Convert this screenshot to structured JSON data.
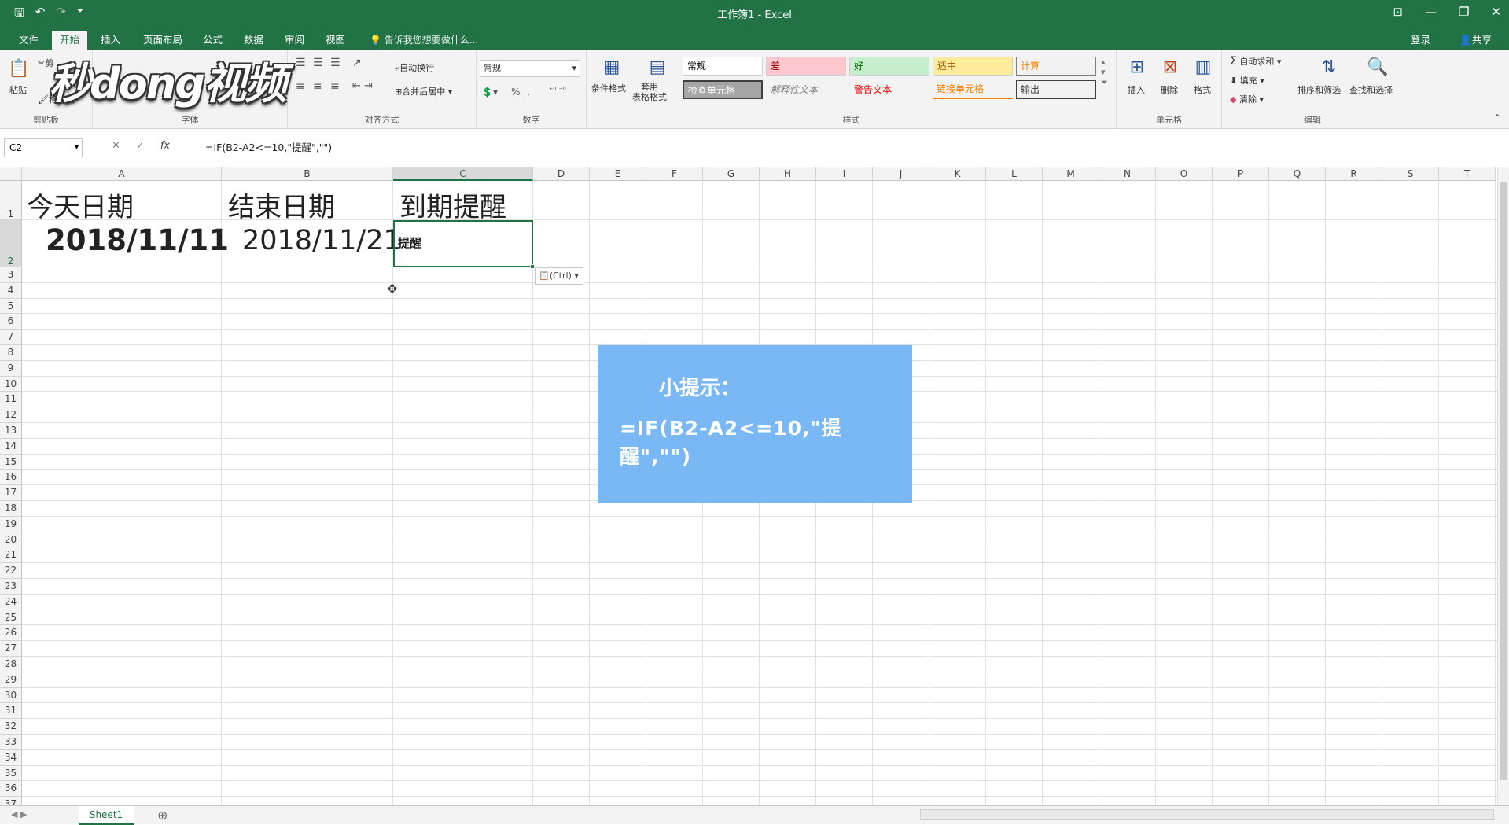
{
  "window": {
    "title": "工作簿1 - Excel"
  },
  "quick_access": {
    "save": "🖫",
    "undo": "↶",
    "redo": "↷",
    "customize": "⏷"
  },
  "window_controls": {
    "display": "⊡",
    "minimize": "—",
    "restore": "❐",
    "close": "✕"
  },
  "ribbon_tabs": [
    {
      "label": "文件"
    },
    {
      "label": "开始"
    },
    {
      "label": "插入"
    },
    {
      "label": "页面布局"
    },
    {
      "label": "公式"
    },
    {
      "label": "数据"
    },
    {
      "label": "审阅"
    },
    {
      "label": "视图"
    }
  ],
  "tell_me": "告诉我您想要做什么...",
  "account": {
    "signin": "登录",
    "share": "共享"
  },
  "ribbon": {
    "clipboard": {
      "paste": "粘贴",
      "cut": "剪",
      "format_painter": "格式刷",
      "label": "剪贴板"
    },
    "font": {
      "label": "字体"
    },
    "alignment": {
      "wrap": "自动换行",
      "merge": "合并后居中",
      "label": "对齐方式"
    },
    "number": {
      "format": "常规",
      "label": "数字"
    },
    "styles": {
      "conditional": "条件格式",
      "table": "套用\n表格格式",
      "cells": [
        "常规",
        "差",
        "好",
        "适中",
        "计算",
        "检查单元格",
        "解释性文本",
        "警告文本",
        "链接单元格",
        "输出"
      ],
      "label": "样式"
    },
    "cells_group": {
      "insert": "插入",
      "delete": "删除",
      "format": "格式",
      "label": "单元格"
    },
    "editing": {
      "autosum": "自动求和",
      "fill": "填充",
      "clear": "清除",
      "sort": "排序和筛选",
      "find": "查找和选择",
      "label": "编辑"
    }
  },
  "watermark": "秒dong视频",
  "formula_bar": {
    "name_box": "C2",
    "formula": "=IF(B2-A2<=10,\"提醒\",\"\")"
  },
  "columns": [
    "A",
    "B",
    "C",
    "D",
    "E",
    "F",
    "G",
    "H",
    "I",
    "J",
    "K",
    "L",
    "M",
    "N",
    "O",
    "P",
    "Q",
    "R",
    "S",
    "T"
  ],
  "rows": [
    "1",
    "2",
    "3",
    "4",
    "5",
    "6",
    "7",
    "8",
    "9",
    "10",
    "11",
    "12",
    "13",
    "14",
    "15",
    "16",
    "17",
    "18",
    "19",
    "20",
    "21",
    "22",
    "23",
    "24",
    "25",
    "26",
    "27",
    "28",
    "29",
    "30",
    "31",
    "32",
    "33",
    "34",
    "35",
    "36",
    "37"
  ],
  "cells": {
    "A1": "今天日期",
    "B1": "结束日期",
    "C1": "到期提醒",
    "A2": "2018/11/11",
    "B2": "2018/11/21",
    "C2": "提醒"
  },
  "paste_options": "(Ctrl)",
  "tip": {
    "title": "小提示：",
    "formula": "=IF(B2-A2<=10,\"提醒\",\"\")"
  },
  "sheet": {
    "tab": "Sheet1",
    "add": "⊕"
  }
}
